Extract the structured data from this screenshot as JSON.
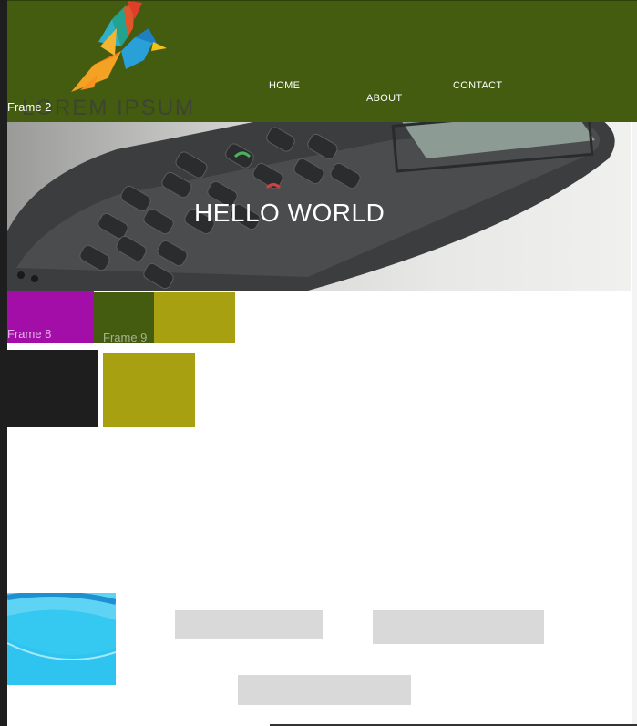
{
  "header": {
    "logo_text": "LOREM IPSUM",
    "frame_label": "Frame 2"
  },
  "nav": {
    "home": "HOME",
    "about": "ABOUT",
    "contact": "CONTACT"
  },
  "hero": {
    "title": "HELLO WORLD"
  },
  "frames": {
    "frame8": "Frame 8",
    "frame9": "Frame 9"
  },
  "colors": {
    "header": "#435c10",
    "purple": "#a30ea8",
    "olive_dark": "#435c10",
    "olive_yellow": "#a7a010",
    "dark": "#1e1e1e",
    "sky_blue": "#35c8f0",
    "placeholder": "#d9d9d9"
  },
  "icons": {
    "logo": "bird-logo-icon",
    "hero": "mobile-phone-image"
  }
}
